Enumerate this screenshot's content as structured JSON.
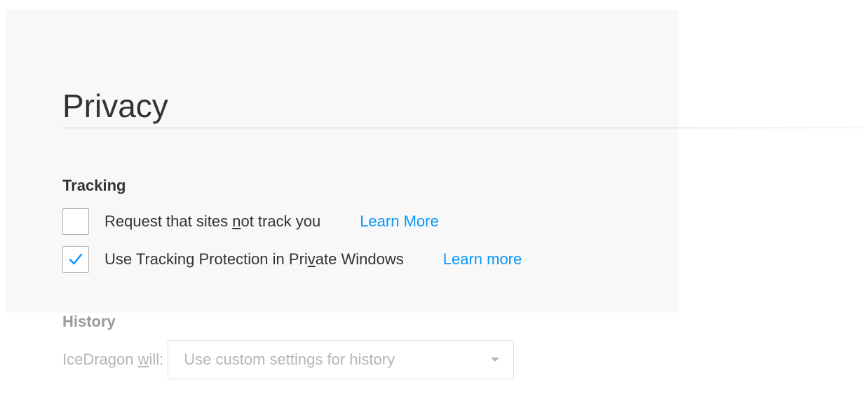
{
  "page": {
    "title": "Privacy"
  },
  "tracking": {
    "heading": "Tracking",
    "dnt": {
      "checked": false,
      "label_before": "Request that sites ",
      "label_access": "n",
      "label_after": "ot track you",
      "link": "Learn More"
    },
    "tp": {
      "checked": true,
      "label_before": "Use Tracking Protection in Pri",
      "label_access": "v",
      "label_after": "ate Windows",
      "link": "Learn more"
    }
  },
  "history": {
    "heading": "History",
    "label_before": "IceDragon ",
    "label_access": "w",
    "label_after": "ill:",
    "select_value": "Use custom settings for history"
  },
  "colors": {
    "link": "#0996f8",
    "check": "#0996f8",
    "text": "#333333",
    "disabled_text": "#b5b5b5"
  }
}
